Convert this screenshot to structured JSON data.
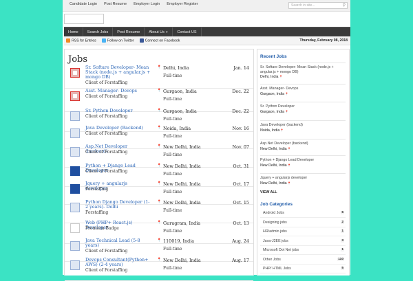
{
  "topnav": {
    "links": [
      "Candidate Login",
      "Post Resume",
      "Employer Login",
      "Employer Register"
    ],
    "search_placeholder": "Search in site..."
  },
  "mainnav": {
    "items": [
      "Home",
      "Search Jobs",
      "Post Resume",
      "About Us",
      "Contact US"
    ]
  },
  "feedbar": {
    "rss": "RSS for Entries",
    "twitter": "Follow on Twitter",
    "facebook": "Connect on Facebook",
    "date": "Thursday, February 08, 2018"
  },
  "main": {
    "heading": "Jobs",
    "jobs": [
      {
        "title": "Sr. Softare Developer- Mean Stack (node.js + angular.js + mongo DB)",
        "company": "Client of Forstaffing",
        "location": "Delhi, India",
        "type": "Full-time",
        "date": "Jan. 14",
        "logo": "we-re-hiring"
      },
      {
        "title": "Asst. Manager- Devops",
        "company": "Client of Forstaffing",
        "location": "Gurgaon, India",
        "type": "Full-time",
        "date": "Dec. 22",
        "logo": "we-re-hiring"
      },
      {
        "title": "Sr. Python Developer",
        "company": "Client of Forstaffing",
        "location": "Gurgaon, India",
        "type": "Full-time",
        "date": "Dec. 22",
        "logo": "hiring"
      },
      {
        "title": "Java Developer (Backend)",
        "company": "Client of Forstaffing",
        "location": "Noida, India",
        "type": "Full-time",
        "date": "Nov. 16",
        "logo": "hiring"
      },
      {
        "title": "Asp.Net Developer (backend)",
        "company": "Client of Forstaffing",
        "location": "New Delhi, India",
        "type": "Full-time",
        "date": "Nov. 07",
        "logo": "hiring"
      },
      {
        "title": "Python + Django Lead Developer",
        "company": "Client of Forstaffing",
        "location": "New Delhi, India",
        "type": "Full-time",
        "date": "Oct. 31",
        "logo": "logo-blue"
      },
      {
        "title": "Jquery + angularjs developer",
        "company": "Forstaffing",
        "location": "New Delhi, India",
        "type": "Full-time",
        "date": "Oct. 17",
        "logo": "logo-blue"
      },
      {
        "title": "Python Django Developer (1-2 years)- Delhi",
        "company": "Forstaffing",
        "location": "New Delhi, India",
        "type": "Full-time",
        "date": "Oct. 15",
        "logo": "hiring"
      },
      {
        "title": "Web (PHP+ React.js) Developer",
        "company": "Premium Badge",
        "location": "Gurugram, India",
        "type": "Full-time",
        "date": "Oct. 13",
        "logo": "blank"
      },
      {
        "title": "Java Technical Lead (5-8 years)",
        "company": "Client of Forstaffing",
        "location": "110019, India",
        "type": "Full-time",
        "date": "Aug. 24",
        "logo": "hiring"
      },
      {
        "title": "Devops Consultant(Python+ AWS) (2-4 years)",
        "company": "Client of Forstaffing",
        "location": "New Delhi, India",
        "type": "Full-time",
        "date": "Aug. 17",
        "logo": "hiring"
      }
    ]
  },
  "sidebar": {
    "recent_heading": "Recent Jobs",
    "recent": [
      {
        "title": "Sr. Softare Developer- Mean Stack (node.js + angular.js + mongo DB)",
        "location": "Delhi, India"
      },
      {
        "title": "Asst. Manager- Devops",
        "location": "Gurgaon, India"
      },
      {
        "title": "Sr. Python Developer",
        "location": "Gurgaon, India"
      },
      {
        "title": "Java Developer (backend)",
        "location": "Noida, India"
      },
      {
        "title": "Asp.Net Developer (backend)",
        "location": "New Delhi, India"
      },
      {
        "title": "Python + Django Lead Developer",
        "location": "New Delhi, India"
      },
      {
        "title": "Jquery + angularjs developer",
        "location": "New Delhi, India"
      }
    ],
    "view_all": "VIEW ALL",
    "categories_heading": "Job Categories",
    "categories": [
      {
        "name": "Android Jobs",
        "count": "6"
      },
      {
        "name": "Designing jobs",
        "count": "2"
      },
      {
        "name": "HR/admin jobs",
        "count": "1"
      },
      {
        "name": "Java-J2EE jobs",
        "count": "3"
      },
      {
        "name": "Microsoft Dot Net jobs",
        "count": "1"
      },
      {
        "name": "Other Jobs",
        "count": "110"
      },
      {
        "name": "PHP/ HTML Jobs",
        "count": "5"
      }
    ]
  },
  "colors": {
    "background": "#3be3c4",
    "link": "#2863b5",
    "nav": "#3a3a3a",
    "hiring_red": "#d9302c",
    "logo_blue": "#1f4fa0"
  }
}
